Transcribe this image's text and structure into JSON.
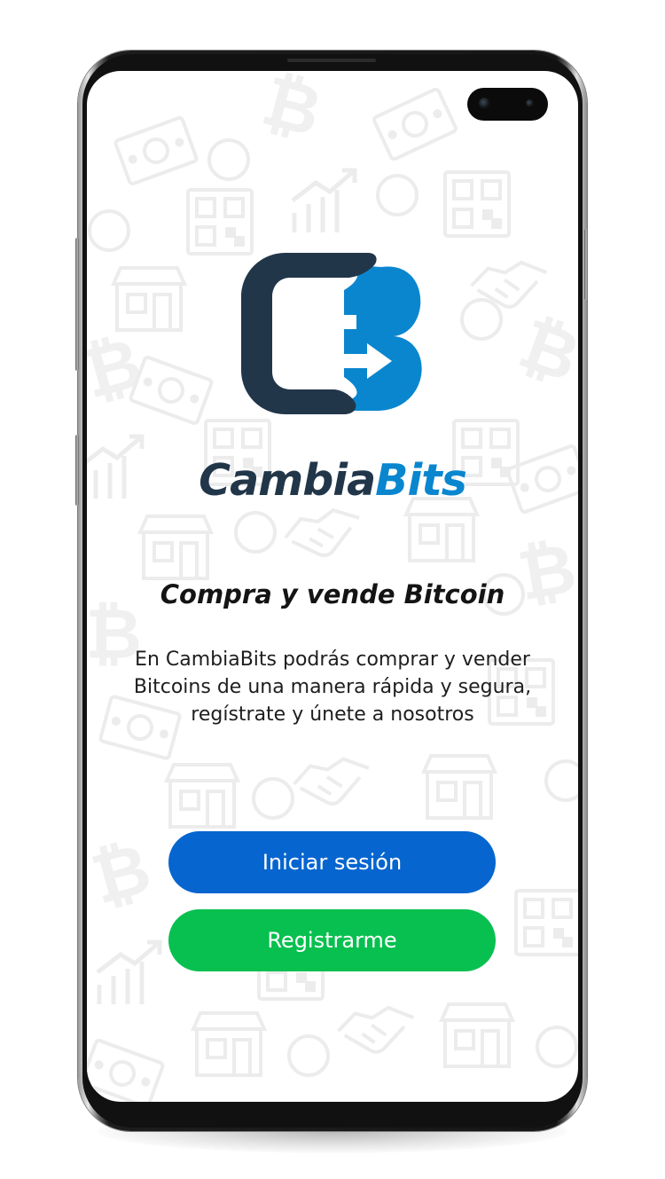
{
  "colors": {
    "brand_dark": "#22364a",
    "brand_blue": "#0a86cf",
    "login_button": "#0665cf",
    "register_button": "#07c04f",
    "background_pattern": "#f1f1f1"
  },
  "logo": {
    "icon": "cambiabits-logo-icon",
    "name_part1": "Cambia",
    "name_part2": "Bits"
  },
  "headline": "Compra y vende Bitcoin",
  "description": "En CambiaBits podrás comprar y vender Bitcoins de una manera rápida y segura, regístrate y únete a nosotros",
  "actions": {
    "login_label": "Iniciar sesión",
    "register_label": "Registrarme"
  }
}
